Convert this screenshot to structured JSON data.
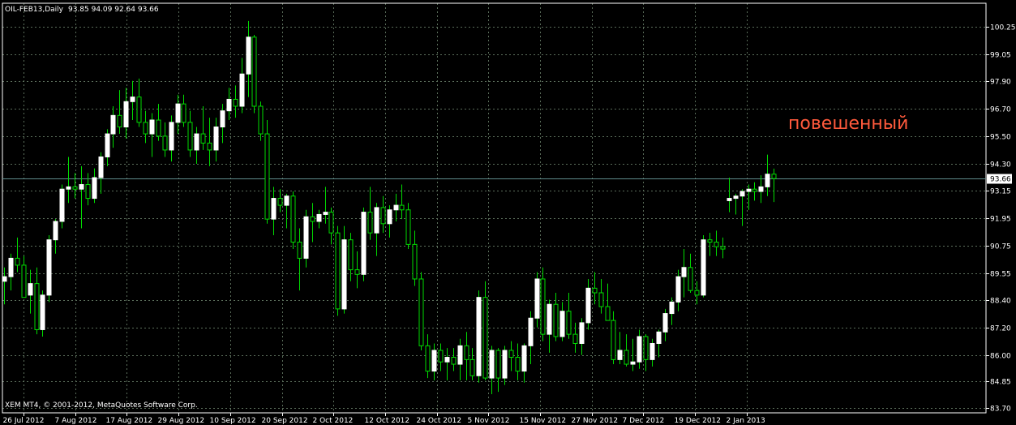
{
  "header": {
    "symbol": "OIL-FEB13,Daily",
    "ohlc": "93.85 94.09 92.64 93.66"
  },
  "footer": {
    "copyright": "XEM MT4, © 2001-2012, MetaQuotes Software Corp."
  },
  "annotation": {
    "text": "повешенный"
  },
  "colors": {
    "background": "#000000",
    "grid": "#5b6e5b",
    "bull_body": "#ffffff",
    "bear_body": "#000000",
    "candle_wick": "#00dd00",
    "price_line": "#5f8c8c",
    "price_badge_bg": "#ffffff",
    "annotation": "#ff5a3c"
  },
  "chart_data": {
    "type": "candlestick",
    "title": "OIL-FEB13,Daily",
    "ylim": [
      83.7,
      101.2
    ],
    "y_ticks": [
      "100.25",
      "99.05",
      "97.90",
      "96.70",
      "95.50",
      "94.30",
      "93.15",
      "91.95",
      "90.75",
      "89.55",
      "88.40",
      "87.20",
      "86.00",
      "84.85",
      "83.70"
    ],
    "x_ticks": [
      "26 Jul 2012",
      "7 Aug 2012",
      "17 Aug 2012",
      "29 Aug 2012",
      "10 Sep 2012",
      "20 Sep 2012",
      "2 Oct 2012",
      "12 Oct 2012",
      "24 Oct 2012",
      "5 Nov 2012",
      "15 Nov 2012",
      "27 Nov 2012",
      "7 Dec 2012",
      "19 Dec 2012",
      "2 Jan 2013"
    ],
    "current_price": "93.66",
    "grid": true,
    "candles": [
      [
        89.2,
        89.8,
        88.2,
        89.4
      ],
      [
        89.4,
        90.4,
        88.8,
        90.2
      ],
      [
        90.2,
        91.1,
        89.6,
        89.9
      ],
      [
        89.9,
        90.3,
        88.6,
        88.5
      ],
      [
        88.6,
        89.7,
        87.8,
        89.1
      ],
      [
        89.1,
        89.8,
        86.9,
        87.1
      ],
      [
        87.1,
        88.8,
        86.8,
        88.6
      ],
      [
        88.6,
        91.2,
        88.3,
        91.0
      ],
      [
        91.0,
        91.9,
        90.4,
        91.8
      ],
      [
        91.8,
        93.4,
        91.5,
        93.2
      ],
      [
        93.2,
        94.6,
        92.6,
        93.3
      ],
      [
        93.3,
        93.9,
        92.8,
        93.2
      ],
      [
        93.2,
        94.2,
        91.5,
        93.4
      ],
      [
        93.4,
        93.9,
        92.5,
        92.8
      ],
      [
        92.8,
        94.1,
        92.6,
        93.7
      ],
      [
        93.7,
        94.8,
        93.0,
        94.6
      ],
      [
        94.6,
        95.8,
        94.2,
        95.6
      ],
      [
        95.6,
        96.8,
        95.0,
        96.4
      ],
      [
        96.4,
        97.5,
        95.6,
        95.9
      ],
      [
        95.9,
        97.6,
        95.4,
        97.0
      ],
      [
        97.0,
        97.9,
        96.2,
        97.2
      ],
      [
        97.2,
        98.0,
        95.9,
        96.1
      ],
      [
        96.1,
        96.6,
        95.2,
        95.6
      ],
      [
        95.6,
        96.5,
        94.6,
        96.2
      ],
      [
        96.2,
        96.9,
        95.3,
        95.5
      ],
      [
        95.5,
        96.1,
        94.6,
        94.9
      ],
      [
        94.9,
        96.4,
        94.4,
        96.1
      ],
      [
        96.1,
        97.3,
        95.6,
        96.9
      ],
      [
        96.9,
        97.3,
        95.9,
        96.1
      ],
      [
        96.1,
        96.6,
        94.6,
        94.9
      ],
      [
        94.9,
        95.9,
        94.3,
        95.6
      ],
      [
        95.6,
        96.8,
        94.9,
        95.2
      ],
      [
        95.2,
        96.3,
        94.2,
        94.9
      ],
      [
        94.9,
        96.3,
        94.4,
        95.9
      ],
      [
        95.9,
        96.9,
        95.2,
        96.6
      ],
      [
        96.6,
        97.6,
        96.2,
        97.1
      ],
      [
        97.1,
        97.7,
        96.3,
        96.8
      ],
      [
        96.8,
        98.9,
        96.5,
        98.2
      ],
      [
        98.2,
        100.5,
        97.2,
        99.8
      ],
      [
        99.8,
        99.9,
        96.5,
        96.8
      ],
      [
        96.8,
        97.0,
        95.3,
        95.6
      ],
      [
        95.6,
        96.2,
        91.7,
        91.9
      ],
      [
        91.9,
        93.3,
        91.2,
        92.8
      ],
      [
        92.8,
        93.2,
        92.2,
        92.5
      ],
      [
        92.5,
        93.0,
        91.5,
        92.9
      ],
      [
        92.9,
        93.1,
        90.6,
        90.9
      ],
      [
        90.9,
        91.5,
        88.8,
        90.2
      ],
      [
        90.2,
        92.3,
        89.8,
        92.0
      ],
      [
        92.0,
        92.6,
        90.9,
        91.8
      ],
      [
        91.8,
        92.3,
        91.5,
        92.1
      ],
      [
        92.1,
        93.3,
        91.7,
        92.2
      ],
      [
        92.2,
        92.4,
        90.8,
        91.3
      ],
      [
        91.3,
        91.6,
        87.7,
        88.0
      ],
      [
        88.0,
        91.6,
        87.8,
        91.0
      ],
      [
        91.0,
        91.3,
        89.2,
        89.7
      ],
      [
        89.7,
        90.5,
        88.9,
        89.5
      ],
      [
        89.5,
        92.4,
        89.2,
        92.2
      ],
      [
        92.2,
        93.3,
        91.0,
        91.3
      ],
      [
        91.3,
        92.6,
        90.3,
        92.4
      ],
      [
        92.4,
        92.9,
        91.3,
        91.7
      ],
      [
        91.7,
        92.5,
        91.1,
        92.3
      ],
      [
        92.3,
        93.0,
        91.8,
        92.5
      ],
      [
        92.5,
        93.4,
        91.9,
        92.3
      ],
      [
        92.3,
        92.6,
        90.6,
        90.8
      ],
      [
        90.8,
        91.4,
        89.0,
        89.3
      ],
      [
        89.3,
        89.6,
        86.2,
        86.4
      ],
      [
        86.4,
        86.9,
        85.0,
        85.3
      ],
      [
        85.3,
        86.5,
        84.9,
        86.2
      ],
      [
        86.2,
        86.5,
        85.3,
        85.7
      ],
      [
        85.7,
        86.3,
        84.9,
        85.9
      ],
      [
        85.9,
        86.3,
        85.3,
        85.6
      ],
      [
        85.6,
        86.7,
        84.9,
        86.4
      ],
      [
        86.4,
        87.0,
        84.9,
        85.8
      ],
      [
        85.8,
        86.3,
        84.9,
        85.1
      ],
      [
        85.1,
        88.8,
        84.8,
        88.5
      ],
      [
        88.5,
        89.2,
        84.9,
        85.0
      ],
      [
        85.0,
        86.4,
        84.3,
        86.2
      ],
      [
        86.2,
        86.3,
        84.4,
        85.0
      ],
      [
        85.0,
        86.4,
        84.7,
        86.2
      ],
      [
        86.2,
        86.6,
        85.3,
        85.9
      ],
      [
        85.9,
        86.5,
        84.9,
        85.3
      ],
      [
        85.3,
        86.5,
        84.8,
        86.4
      ],
      [
        86.4,
        87.9,
        85.6,
        87.6
      ],
      [
        87.6,
        89.6,
        87.2,
        89.3
      ],
      [
        89.3,
        89.8,
        86.6,
        86.9
      ],
      [
        86.9,
        88.4,
        86.1,
        88.2
      ],
      [
        88.2,
        88.7,
        86.6,
        86.8
      ],
      [
        86.8,
        88.3,
        86.6,
        87.9
      ],
      [
        87.9,
        88.7,
        86.7,
        86.9
      ],
      [
        86.9,
        87.4,
        86.1,
        86.5
      ],
      [
        86.5,
        87.6,
        86.0,
        87.4
      ],
      [
        87.4,
        89.3,
        87.1,
        88.9
      ],
      [
        88.9,
        89.6,
        88.2,
        88.7
      ],
      [
        88.7,
        89.3,
        87.8,
        88.1
      ],
      [
        88.1,
        89.1,
        87.6,
        87.5
      ],
      [
        87.5,
        87.9,
        85.6,
        85.8
      ],
      [
        85.8,
        87.0,
        85.6,
        86.2
      ],
      [
        86.2,
        86.9,
        85.5,
        85.6
      ],
      [
        85.6,
        86.7,
        85.3,
        85.7
      ],
      [
        85.7,
        87.1,
        85.4,
        86.8
      ],
      [
        86.8,
        86.9,
        85.3,
        85.8
      ],
      [
        85.8,
        86.7,
        85.5,
        86.5
      ],
      [
        86.5,
        87.1,
        85.9,
        87.0
      ],
      [
        87.0,
        88.0,
        86.6,
        87.8
      ],
      [
        87.8,
        88.5,
        87.3,
        88.3
      ],
      [
        88.3,
        89.7,
        87.9,
        89.4
      ],
      [
        89.4,
        90.6,
        88.5,
        89.8
      ],
      [
        89.8,
        90.4,
        88.7,
        88.8
      ],
      [
        88.8,
        89.2,
        88.2,
        88.6
      ],
      [
        88.6,
        91.2,
        88.5,
        91.0
      ],
      [
        91.0,
        91.3,
        90.3,
        90.9
      ],
      [
        90.9,
        91.4,
        90.3,
        90.7
      ],
      [
        90.7,
        91.1,
        90.2,
        90.6
      ],
      [
        92.7,
        93.7,
        92.2,
        92.8
      ],
      [
        92.8,
        93.0,
        92.1,
        92.9
      ],
      [
        92.9,
        93.2,
        91.6,
        93.1
      ],
      [
        93.1,
        93.4,
        92.3,
        93.2
      ],
      [
        93.2,
        93.5,
        92.7,
        93.1
      ],
      [
        93.1,
        93.8,
        92.6,
        93.3
      ],
      [
        93.3,
        94.7,
        92.9,
        93.85
      ],
      [
        93.85,
        94.09,
        92.64,
        93.66
      ]
    ]
  }
}
